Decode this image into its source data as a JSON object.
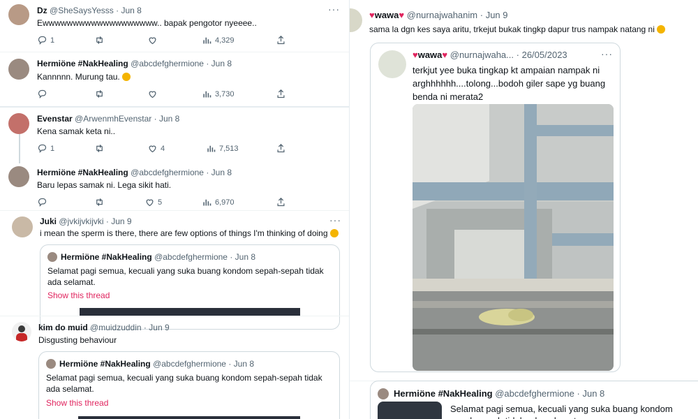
{
  "left": {
    "tweets": [
      {
        "name": "Dz",
        "handle": "@SheSaysYesss",
        "date": "Jun 8",
        "text": "Ewwwwwwwwwwwwwwwwwww.. bapak pengotor nyeeee..",
        "replies": "1",
        "likes": "",
        "views": "4,329"
      },
      {
        "name": "Hermiöne #NakHealing",
        "handle": "@abcdefghermione",
        "date": "Jun 8",
        "text": "Kannnnn. Murung tau.",
        "replies": "",
        "likes": "",
        "views": "3,730"
      },
      {
        "name": "Evenstar",
        "handle": "@ArwenmhEvenstar",
        "date": "Jun 8",
        "text": "Kena samak keta ni..",
        "replies": "1",
        "likes": "4",
        "views": "7,513"
      },
      {
        "name": "Hermiöne #NakHealing",
        "handle": "@abcdefghermione",
        "date": "Jun 8",
        "text": "Baru lepas samak ni. Lega sikit hati.",
        "replies": "",
        "likes": "5",
        "views": "6,970"
      },
      {
        "name": "Juki",
        "handle": "@jvkijvkijvki",
        "date": "Jun 9",
        "text": "i mean the sperm is there, there are few options of things I'm thinking of doing"
      },
      {
        "name": "kim do muid",
        "handle": "@muidzuddin",
        "date": "Jun 9",
        "text": "Disgusting behaviour"
      }
    ],
    "quote": {
      "name": "Hermiöne #NakHealing",
      "handle": "@abcdefghermione",
      "date": "Jun 8",
      "text": "Selamat pagi semua, kecuali yang suka buang kondom sepah-sepah tidak ada selamat.",
      "show_thread": "Show this thread"
    }
  },
  "right": {
    "main": {
      "name": "wawa",
      "handle": "@nurnajwahanim",
      "date": "Jun 9",
      "text": "sama la dgn kes saya aritu, trkejut bukak tingkp dapur trus nampak natang ni"
    },
    "inner": {
      "name": "wawa",
      "handle": "@nurnajwaha...",
      "date": "26/05/2023",
      "text": "terkjut yee buka tingkap kt ampaian nampak ni arghhhhhh....tolong...bodoh giler sape yg buang benda ni merata2"
    },
    "bottom": {
      "name": "Hermiöne #NakHealing",
      "handle": "@abcdefghermione",
      "date": "Jun 8",
      "text": "Selamat pagi semua, kecuali yang suka buang kondom sepah-sepah tidak ada selamat"
    }
  },
  "colors": {
    "border": "#cfd9de",
    "muted": "#536471",
    "link": "#e0245e"
  }
}
